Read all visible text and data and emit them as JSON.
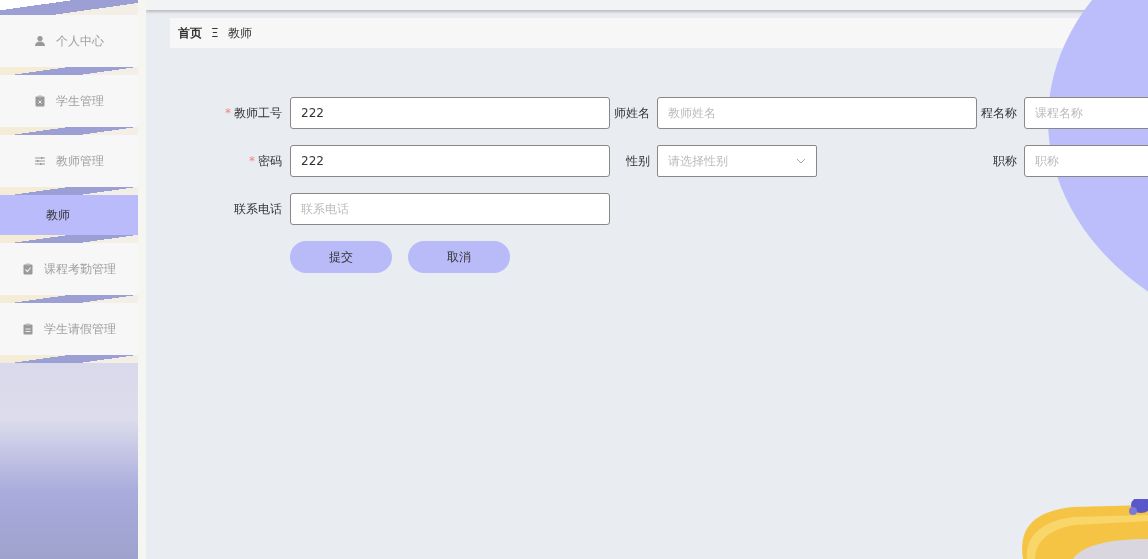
{
  "sidebar": {
    "items": [
      {
        "label": "个人中心",
        "kind": "menu",
        "selected": false
      },
      {
        "label": "学生管理",
        "kind": "menu",
        "selected": false
      },
      {
        "label": "教师管理",
        "kind": "menu",
        "selected": false
      },
      {
        "label": "教师",
        "kind": "submenu",
        "selected": true
      },
      {
        "label": "课程考勤管理",
        "kind": "menu",
        "selected": false
      },
      {
        "label": "学生请假管理",
        "kind": "menu",
        "selected": false
      }
    ]
  },
  "breadcrumb": {
    "items": [
      "首页",
      "教师"
    ],
    "separator": "Ξ"
  },
  "form": {
    "fields": [
      {
        "label": "教师工号",
        "required": true,
        "kind": "text",
        "value": "222"
      },
      {
        "label": "师姓名",
        "required": false,
        "kind": "text",
        "placeholder": "教师姓名"
      },
      {
        "label": "程名称",
        "required": false,
        "kind": "text",
        "placeholder": "课程名称"
      },
      {
        "label": "密码",
        "required": true,
        "kind": "text",
        "value": "222"
      },
      {
        "label": "性别",
        "required": false,
        "kind": "select",
        "placeholder": "请选择性别"
      },
      {
        "label": "职称",
        "required": false,
        "kind": "text",
        "placeholder": "职称"
      },
      {
        "label": "联系电话",
        "required": false,
        "kind": "text",
        "placeholder": "联系电话"
      }
    ],
    "required_mark": "*",
    "buttons": [
      "提交",
      "取消"
    ]
  }
}
